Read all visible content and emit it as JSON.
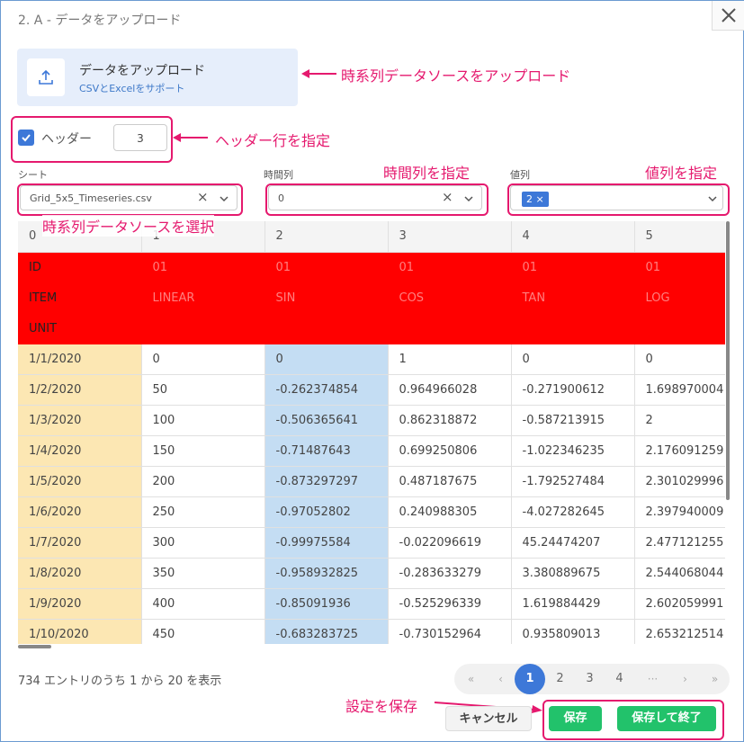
{
  "window": {
    "title": "2. A - データをアップロード"
  },
  "upload": {
    "title": "データをアップロード",
    "subtitle": "CSVとExcelをサポート"
  },
  "header_option": {
    "label": "ヘッダー",
    "value": "3"
  },
  "sheet": {
    "label": "シート",
    "value": "Grid_5x5_Timeseries.csv"
  },
  "time_column": {
    "label": "時間列",
    "value": "0"
  },
  "value_column": {
    "label": "値列",
    "tag": "2"
  },
  "annotations": {
    "upload": "時系列データソースをアップロード",
    "header": "ヘッダー行を指定",
    "time": "時間列を指定",
    "value": "値列を指定",
    "source": "時系列データソースを選択",
    "save": "設定を保存"
  },
  "table": {
    "columns": [
      "0",
      "1",
      "2",
      "3",
      "4",
      "5"
    ],
    "header_rows": [
      [
        "ID",
        "01",
        "01",
        "01",
        "01",
        "01"
      ],
      [
        "ITEM",
        "LINEAR",
        "SIN",
        "COS",
        "TAN",
        "LOG"
      ],
      [
        "UNIT",
        "",
        "",
        "",
        "",
        ""
      ]
    ],
    "rows": [
      [
        "1/1/2020",
        "0",
        "0",
        "1",
        "0",
        "0"
      ],
      [
        "1/2/2020",
        "50",
        "-0.262374854",
        "0.964966028",
        "-0.271900612",
        "1.698970004"
      ],
      [
        "1/3/2020",
        "100",
        "-0.506365641",
        "0.862318872",
        "-0.587213915",
        "2"
      ],
      [
        "1/4/2020",
        "150",
        "-0.71487643",
        "0.699250806",
        "-1.022346235",
        "2.176091259"
      ],
      [
        "1/5/2020",
        "200",
        "-0.873297297",
        "0.487187675",
        "-1.792527484",
        "2.301029996"
      ],
      [
        "1/6/2020",
        "250",
        "-0.97052802",
        "0.240988305",
        "-4.027282645",
        "2.397940009"
      ],
      [
        "1/7/2020",
        "300",
        "-0.99975584",
        "-0.022096619",
        "45.24474207",
        "2.477121255"
      ],
      [
        "1/8/2020",
        "350",
        "-0.958932825",
        "-0.283633279",
        "3.380889675",
        "2.544068044"
      ],
      [
        "1/9/2020",
        "400",
        "-0.85091936",
        "-0.525296339",
        "1.619884429",
        "2.602059991"
      ],
      [
        "1/10/2020",
        "450",
        "-0.683283725",
        "-0.730152964",
        "0.935809013",
        "2.653212514"
      ]
    ]
  },
  "footer": {
    "entries": "734 エントリのうち 1 から 20 を表示"
  },
  "pagination": {
    "first": "«",
    "prev": "‹",
    "pages": [
      "1",
      "2",
      "3",
      "4"
    ],
    "ellipsis": "···",
    "next": "›",
    "last": "»",
    "active": "1"
  },
  "buttons": {
    "cancel": "キャンセル",
    "save": "保存",
    "save_close": "保存して終了"
  },
  "colors": {
    "accent": "#3d78d8",
    "annotation": "#e5196e",
    "header_row": "#ff0000",
    "time_col": "#fce7b3",
    "value_col": "#c4ddf3",
    "save": "#22c26b"
  }
}
